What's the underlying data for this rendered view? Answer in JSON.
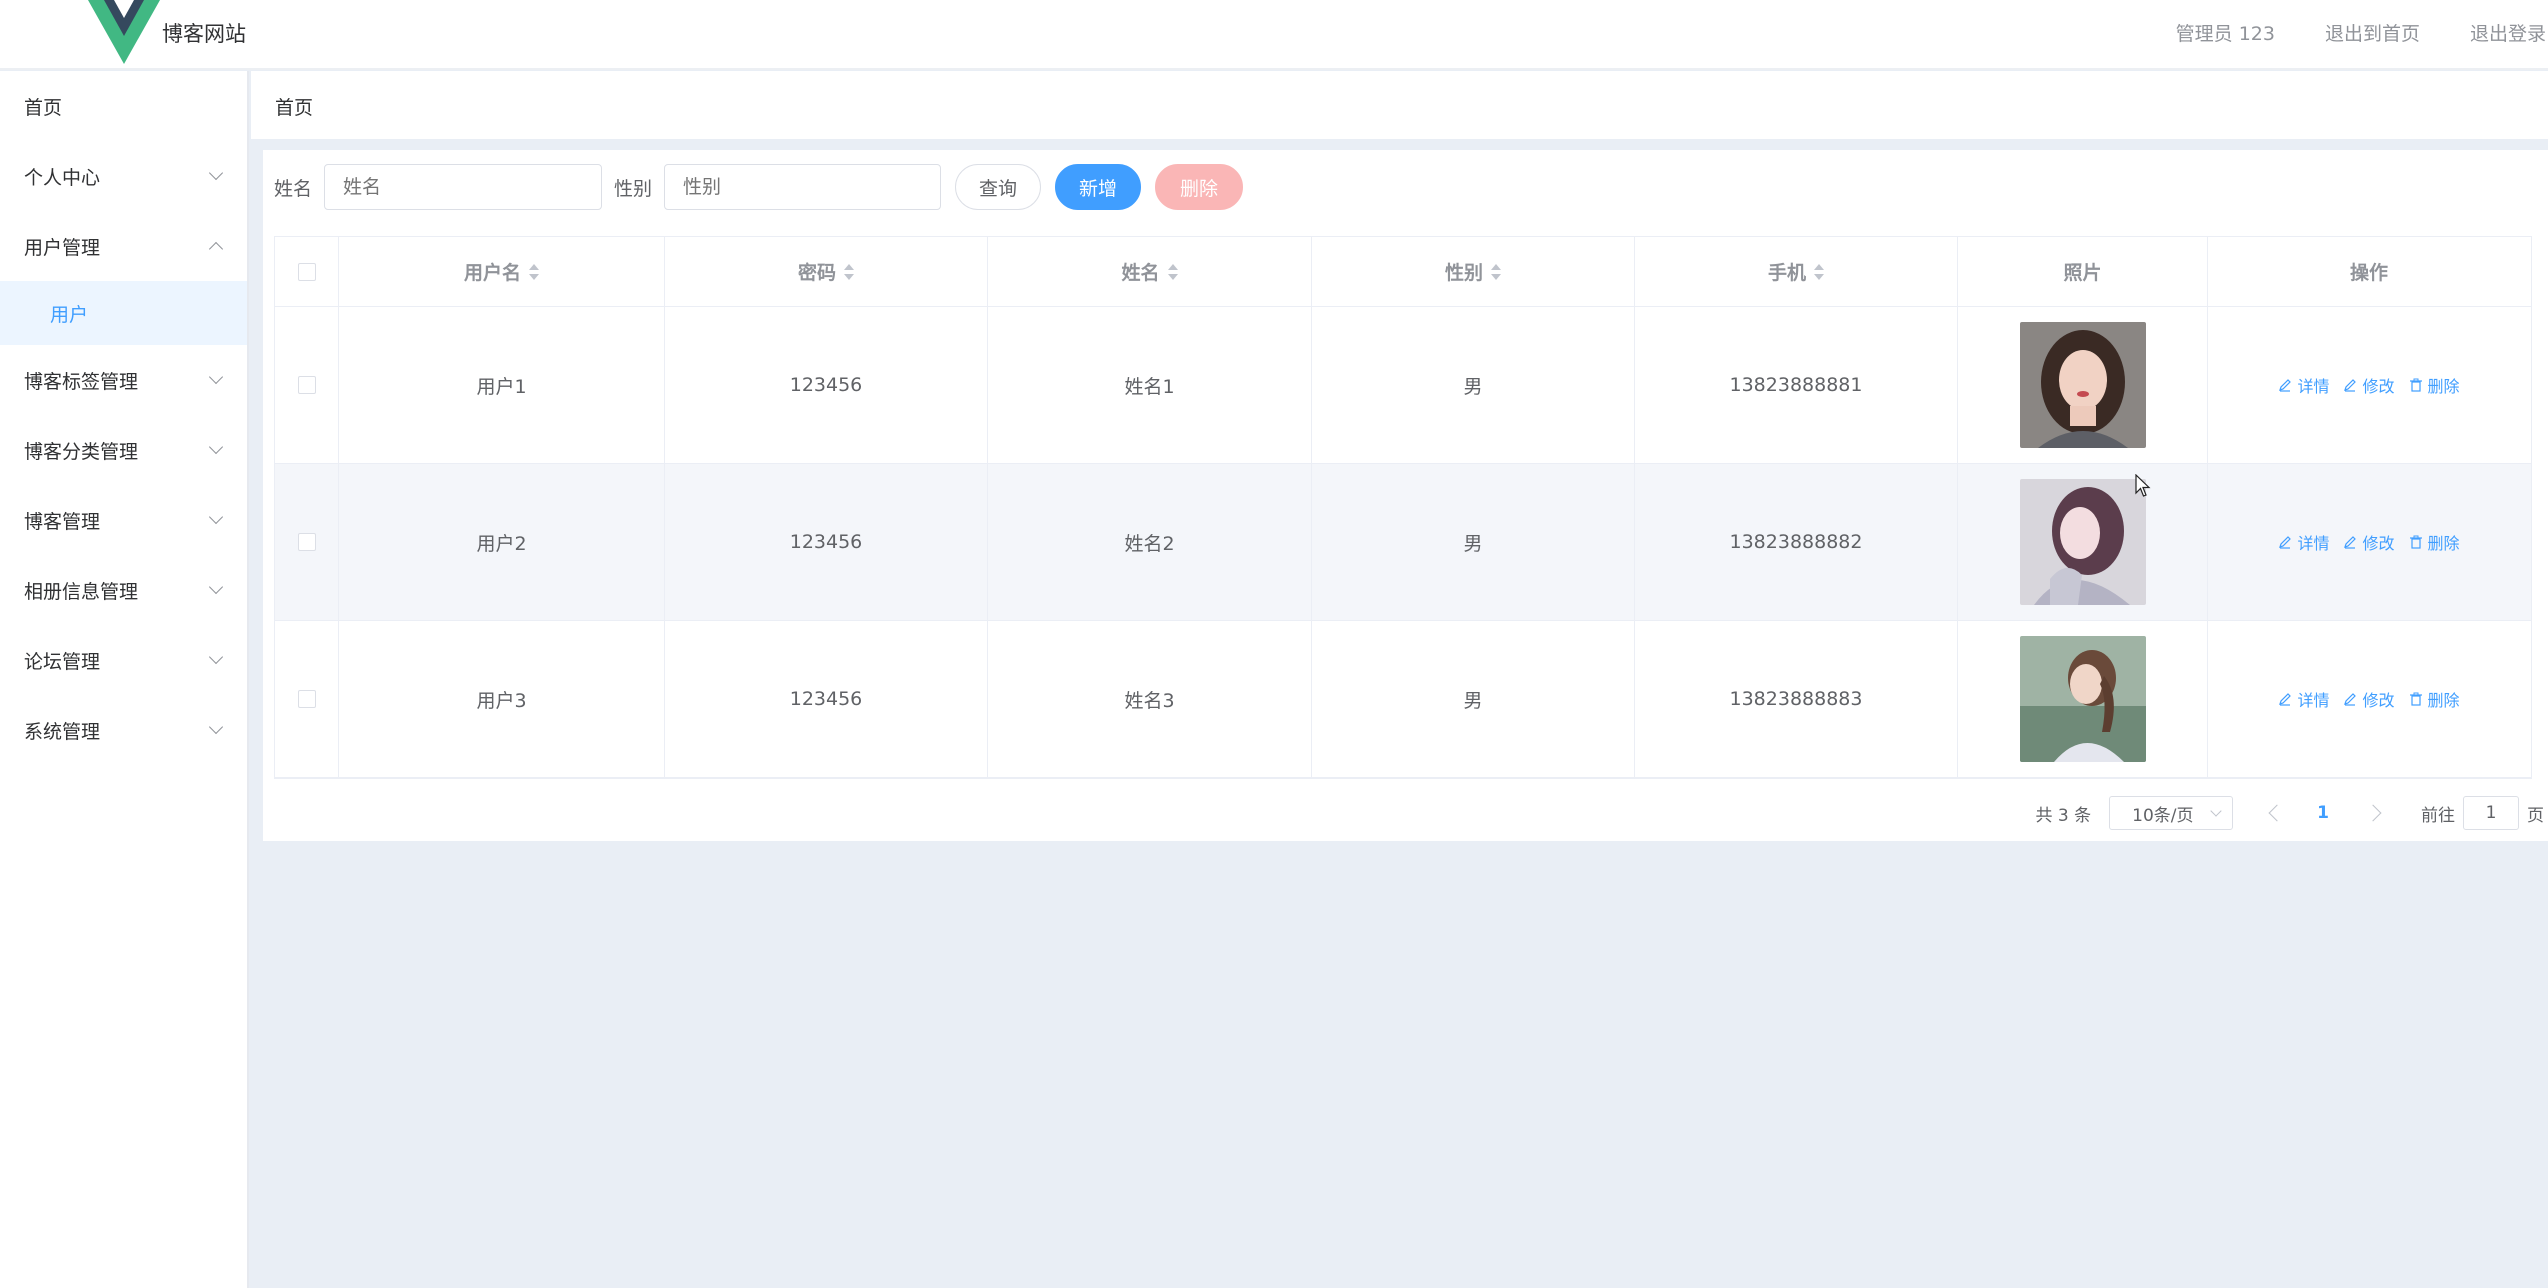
{
  "header": {
    "site_title": "博客网站",
    "user_label": "管理员 123",
    "home_link": "退出到首页",
    "logout_link": "退出登录"
  },
  "sidebar": {
    "items": [
      {
        "label": "首页"
      },
      {
        "label": "个人中心"
      },
      {
        "label": "用户管理"
      },
      {
        "label": "用户"
      },
      {
        "label": "博客标签管理"
      },
      {
        "label": "博客分类管理"
      },
      {
        "label": "博客管理"
      },
      {
        "label": "相册信息管理"
      },
      {
        "label": "论坛管理"
      },
      {
        "label": "系统管理"
      }
    ]
  },
  "breadcrumb": {
    "current": "首页"
  },
  "search": {
    "name_label": "姓名",
    "name_placeholder": "姓名",
    "gender_label": "性别",
    "gender_placeholder": "性别",
    "query_button": "查询",
    "add_button": "新增",
    "delete_button": "删除"
  },
  "table": {
    "columns": [
      "用户名",
      "密码",
      "姓名",
      "性别",
      "手机",
      "照片",
      "操作"
    ],
    "rows": [
      {
        "username": "用户1",
        "password": "123456",
        "name": "姓名1",
        "gender": "男",
        "phone": "13823888881"
      },
      {
        "username": "用户2",
        "password": "123456",
        "name": "姓名2",
        "gender": "男",
        "phone": "13823888882"
      },
      {
        "username": "用户3",
        "password": "123456",
        "name": "姓名3",
        "gender": "男",
        "phone": "13823888883"
      }
    ],
    "actions": {
      "detail": "详情",
      "edit": "修改",
      "delete": "删除"
    }
  },
  "pagination": {
    "total": "共 3 条",
    "page_size": "10条/页",
    "current_page": "1",
    "goto_label": "前往",
    "goto_value": "1",
    "page_suffix": "页"
  },
  "colors": {
    "primary": "#409eff",
    "danger_disabled": "#fab6b6",
    "logo_green": "#41b883",
    "logo_dark": "#35495e"
  }
}
